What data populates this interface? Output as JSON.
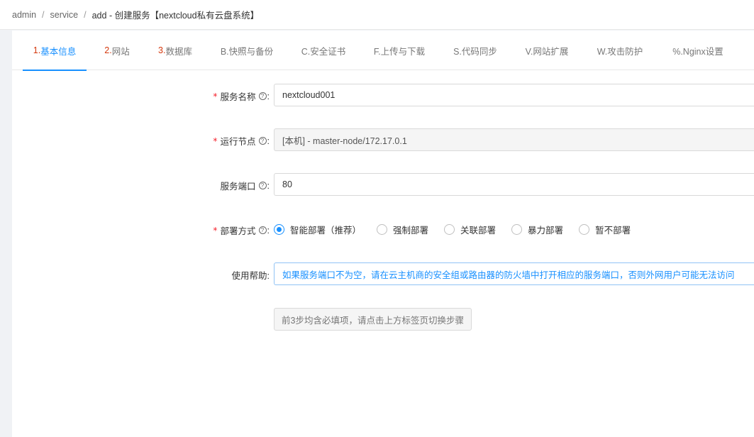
{
  "breadcrumb": {
    "items": [
      "admin",
      "service"
    ],
    "current": "add  -  创建服务【nextcloud私有云盘系统】",
    "separator": "/"
  },
  "tabs": [
    {
      "num": "1.",
      "label": "基本信息"
    },
    {
      "num": "2.",
      "label": "网站"
    },
    {
      "num": "3.",
      "label": "数据库"
    },
    {
      "num": "",
      "label": "B.快照与备份"
    },
    {
      "num": "",
      "label": "C.安全证书"
    },
    {
      "num": "",
      "label": "F.上传与下载"
    },
    {
      "num": "",
      "label": "S.代码同步"
    },
    {
      "num": "",
      "label": "V.网站扩展"
    },
    {
      "num": "",
      "label": "W.攻击防护"
    },
    {
      "num": "",
      "label": "%.Nginx设置"
    }
  ],
  "form": {
    "service_name": {
      "label": "服务名称",
      "value": "nextcloud001",
      "required": true
    },
    "run_node": {
      "label": "运行节点",
      "value": "[本机] - master-node/172.17.0.1",
      "required": true
    },
    "service_port": {
      "label": "服务端口",
      "value": "80",
      "required": false
    },
    "deploy_mode": {
      "label": "部署方式",
      "required": true,
      "options": [
        "智能部署（推荐）",
        "强制部署",
        "关联部署",
        "暴力部署",
        "暂不部署"
      ],
      "selected": "智能部署（推荐）"
    },
    "help": {
      "label": "使用帮助:",
      "text": "如果服务端口不为空，请在云主机商的安全组或路由器的防火墙中打开相应的服务端口，否则外网用户可能无法访问"
    },
    "submit_label": "前3步均含必填项，请点击上方标签页切换步骤"
  },
  "colors": {
    "accent": "#1890ff",
    "required": "#f5222d",
    "tab_number": "#d4380d"
  }
}
